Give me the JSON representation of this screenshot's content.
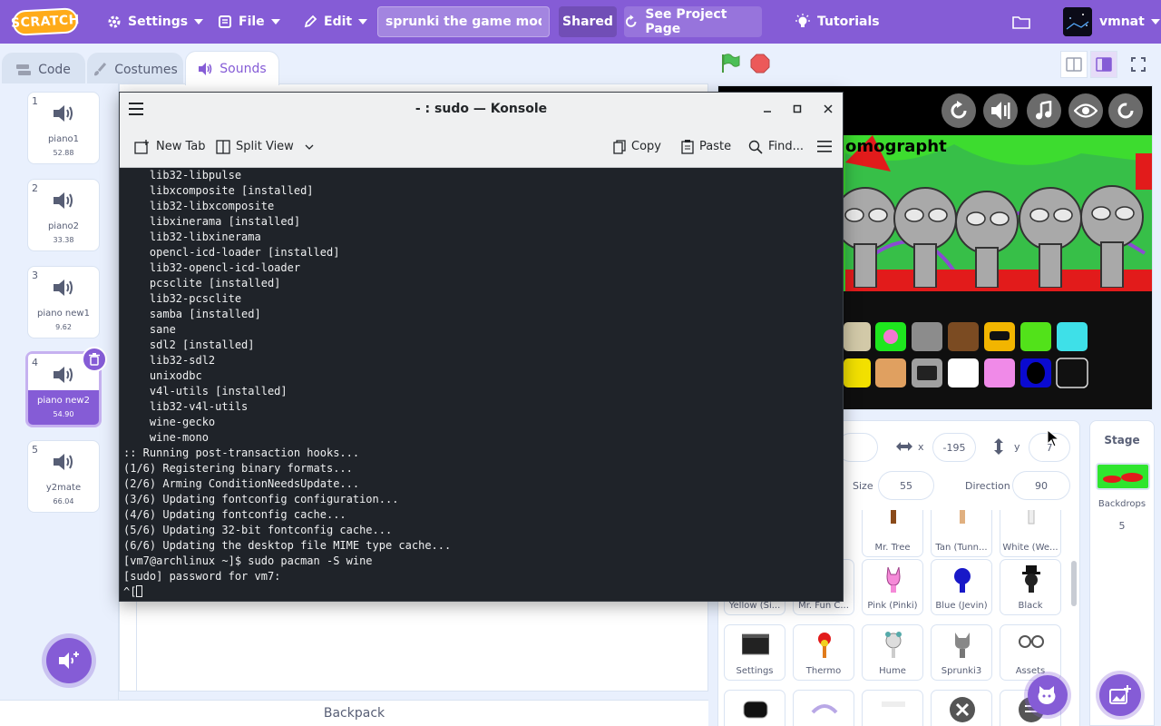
{
  "menubar": {
    "logo": "SCRATCH",
    "settings": "Settings",
    "file": "File",
    "edit": "Edit",
    "project_title": "sprunki the game mod",
    "shared": "Shared",
    "see_project": "See Project Page",
    "tutorials": "Tutorials",
    "username": "vmnat"
  },
  "tabs": {
    "code": "Code",
    "costumes": "Costumes",
    "sounds": "Sounds"
  },
  "sounds": [
    {
      "num": "1",
      "name": "piano1",
      "duration": "52.88"
    },
    {
      "num": "2",
      "name": "piano2",
      "duration": "33.38"
    },
    {
      "num": "3",
      "name": "piano new1",
      "duration": "9.62"
    },
    {
      "num": "4",
      "name": "piano new2",
      "duration": "54.90"
    },
    {
      "num": "5",
      "name": "y2mate",
      "duration": "66.04"
    }
  ],
  "backpack": "Backpack",
  "stage": {
    "title": "omographt"
  },
  "sprite_info": {
    "x_label": "x",
    "x_value": "-195",
    "y_label": "y",
    "y_value": "7",
    "size_label": "Size",
    "size_value": "55",
    "direction_label": "Direction",
    "direction_value": "90"
  },
  "sprites": [
    {
      "name": "Yellow (Si..."
    },
    {
      "name": "Mr. Fun C..."
    },
    {
      "name": "Mr. Tree"
    },
    {
      "name": "Tan (Tunn..."
    },
    {
      "name": "White (We..."
    },
    {
      "name": "Pink (Pinki)"
    },
    {
      "name": "Blue (Jevin)"
    },
    {
      "name": "Black"
    },
    {
      "name": "Settings"
    },
    {
      "name": "Thermo"
    },
    {
      "name": "Hume"
    },
    {
      "name": "Sprunki3"
    },
    {
      "name": "Assets"
    }
  ],
  "stage_pane": {
    "label": "Stage",
    "backdrops_label": "Backdrops",
    "backdrops_count": "5"
  },
  "konsole": {
    "title": "- : sudo — Konsole",
    "new_tab": "New Tab",
    "split_view": "Split View",
    "copy": "Copy",
    "paste": "Paste",
    "find": "Find...",
    "lines": [
      "    lib32-libpulse",
      "    libxcomposite [installed]",
      "    lib32-libxcomposite",
      "    libxinerama [installed]",
      "    lib32-libxinerama",
      "    opencl-icd-loader [installed]",
      "    lib32-opencl-icd-loader",
      "    pcsclite [installed]",
      "    lib32-pcsclite",
      "    samba [installed]",
      "    sane",
      "    sdl2 [installed]",
      "    lib32-sdl2",
      "    unixodbc",
      "    v4l-utils [installed]",
      "    lib32-v4l-utils",
      "    wine-gecko",
      "    wine-mono",
      ":: Running post-transaction hooks...",
      "(1/6) Registering binary formats...",
      "(2/6) Arming ConditionNeedsUpdate...",
      "(3/6) Updating fontconfig configuration...",
      "(4/6) Updating fontconfig cache...",
      "(5/6) Updating 32-bit fontconfig cache...",
      "(6/6) Updating the desktop file MIME type cache...",
      "[vm7@archlinux ~]$ sudo pacman -S wine",
      "[sudo] password for vm7:",
      "^["
    ]
  },
  "colors": {
    "scratch_purple": "#855cd6",
    "stage_green": "#2fe52f",
    "terminal_bg": "#1f2329"
  }
}
